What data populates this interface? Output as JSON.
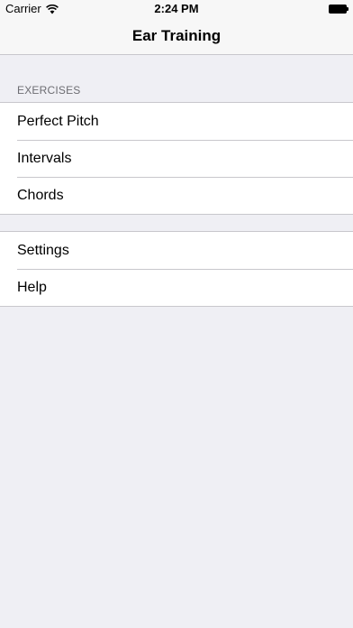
{
  "status_bar": {
    "carrier": "Carrier",
    "time": "2:24 PM",
    "wifi_icon": "wifi-icon",
    "battery_icon": "battery-full-icon"
  },
  "nav": {
    "title": "Ear Training"
  },
  "sections": [
    {
      "header": "EXERCISES",
      "items": [
        {
          "label": "Perfect Pitch"
        },
        {
          "label": "Intervals"
        },
        {
          "label": "Chords"
        }
      ]
    },
    {
      "header": "",
      "items": [
        {
          "label": "Settings"
        },
        {
          "label": "Help"
        }
      ]
    }
  ],
  "colors": {
    "background": "#efeff4",
    "bar": "#f7f7f7",
    "separator": "#c8c7cc",
    "section_header": "#6d6d72"
  }
}
